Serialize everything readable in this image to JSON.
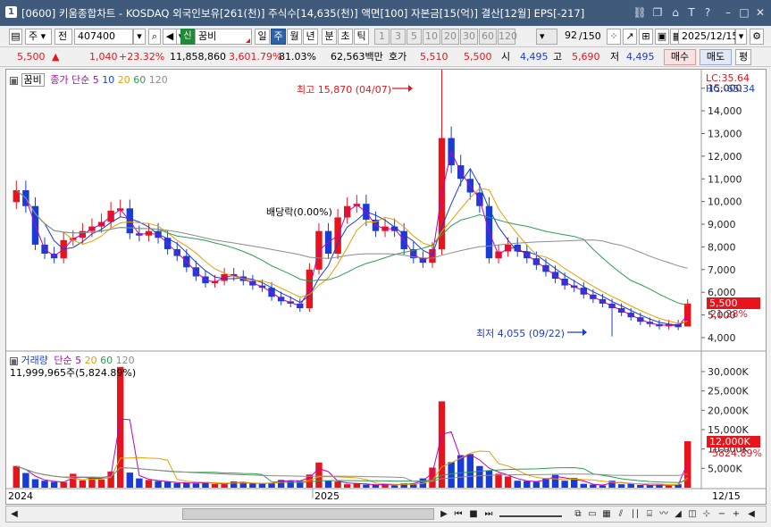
{
  "window": {
    "number": "1",
    "title": "[0600] 키움종합차트 - KOSDAQ 외국인보유[261(천)] 주식수[14,635(천)] 액면[100] 자본금[15(억)] 결산[12월] EPS[-217]"
  },
  "toolbar": {
    "market": "주",
    "mode": "전",
    "code": "407400",
    "badge": "신",
    "name": "꿈비",
    "periods": [
      "일",
      "주",
      "월",
      "년",
      "분",
      "초",
      "틱"
    ],
    "selected_period": "주",
    "intervals": [
      "1",
      "3",
      "5",
      "10",
      "20",
      "30",
      "60",
      "120"
    ],
    "count": "92",
    "total": "/150",
    "date": "2025/12/15"
  },
  "quote": {
    "price": "5,500",
    "arrow": "▲",
    "change": "1,040",
    "change_pct": "+23.32%",
    "volume": "11,858,860",
    "volume_ratio": "3,601.79%",
    "foreign": "81.03%",
    "amount": "62,563백만",
    "bid_label": "호가",
    "bid1": "5,510",
    "bid2": "5,500",
    "open_label": "시",
    "open": "4,495",
    "high_label": "고",
    "high": "5,690",
    "low_label": "저",
    "low": "4,495",
    "buy": "매수",
    "sell": "매도",
    "eval": "평"
  },
  "price_pane": {
    "name_tag": "꿈비",
    "ma_label": "종가 단순",
    "ma_periods": [
      "5",
      "10",
      "20",
      "60",
      "120"
    ],
    "ma_colors": [
      "#c000c0",
      "#1a3cd6",
      "#e8a000",
      "#2aa050",
      "#8c8c8c"
    ],
    "lc": "LC:35.64",
    "hc": "HC:-65.34",
    "high_note": "최고 15,870 (04/07)",
    "low_note": "최저 4,055 (09/22)",
    "div_note": "배당락(0.00%)",
    "current_tag": "5,500",
    "current_pct": "21.28%",
    "y_ticks": [
      "15,000",
      "14,000",
      "13,000",
      "12,000",
      "11,000",
      "10,000",
      "9,000",
      "8,000",
      "7,000",
      "6,000",
      "5,000",
      "4,000"
    ]
  },
  "volume_pane": {
    "label": "거래량",
    "ma_label": "단순",
    "ma_periods": [
      "5",
      "20",
      "60",
      "120"
    ],
    "ma_colors": [
      "#c000c0",
      "#e8a000",
      "#2aa050",
      "#8c8c8c"
    ],
    "value_text": "11,999,965주(5,824.89%)",
    "current_tag": "12,000K",
    "current_pct": "5824.89%",
    "y_ticks": [
      "30,000K",
      "25,000K",
      "20,000K",
      "15,000K",
      "10,000K",
      "5,000K"
    ]
  },
  "x_axis": {
    "labels": [
      "2024",
      "2025"
    ],
    "last_date": "12/15"
  },
  "colors": {
    "up": "#e8141c",
    "down": "#1a3cd6",
    "title_bar": "#3f5a7a",
    "selected": "#2f63a8"
  },
  "chart_data": {
    "type": "candlestick",
    "ohlc_range": {
      "high": 15870,
      "low": 4055
    },
    "last_candle": {
      "open": 4495,
      "high": 5690,
      "low": 4495,
      "close": 5500
    },
    "close_series": [
      10500,
      9800,
      8100,
      7700,
      7500,
      8300,
      8400,
      8700,
      8900,
      9100,
      9600,
      9700,
      8600,
      8500,
      8700,
      8400,
      7900,
      7600,
      7100,
      6700,
      6400,
      6500,
      6800,
      6700,
      6500,
      6300,
      6200,
      5800,
      5600,
      5500,
      5300,
      7000,
      8700,
      7700,
      9300,
      9800,
      9900,
      9200,
      8700,
      8900,
      8700,
      7900,
      7500,
      7300,
      7900,
      12800,
      11600,
      11000,
      10400,
      9800,
      7500,
      7800,
      8100,
      7800,
      7500,
      7200,
      6900,
      6600,
      6300,
      6200,
      5900,
      5700,
      5500,
      5300,
      5100,
      4900,
      4700,
      4600,
      4500,
      4600,
      4460,
      5500
    ],
    "volume_series_k": [
      5600,
      3800,
      2200,
      1800,
      1500,
      1400,
      3600,
      1900,
      2800,
      2100,
      4200,
      31200,
      3900,
      2400,
      2000,
      1700,
      1500,
      1200,
      1300,
      1100,
      1500,
      1000,
      900,
      1600,
      1200,
      1100,
      1000,
      1300,
      2000,
      1700,
      1800,
      3400,
      6500,
      1800,
      1600,
      900,
      1200,
      800,
      700,
      900,
      600,
      1100,
      1000,
      2400,
      5200,
      22300,
      6600,
      8400,
      8700,
      5600,
      4500,
      3600,
      2900,
      1800,
      1700,
      1500,
      2500,
      3300,
      1800,
      2500,
      1000,
      800,
      600,
      1800,
      900,
      1200,
      700,
      600,
      800,
      500,
      900,
      12000
    ],
    "y_range": [
      4000,
      15500
    ],
    "volume_range_k": [
      0,
      33000
    ]
  }
}
